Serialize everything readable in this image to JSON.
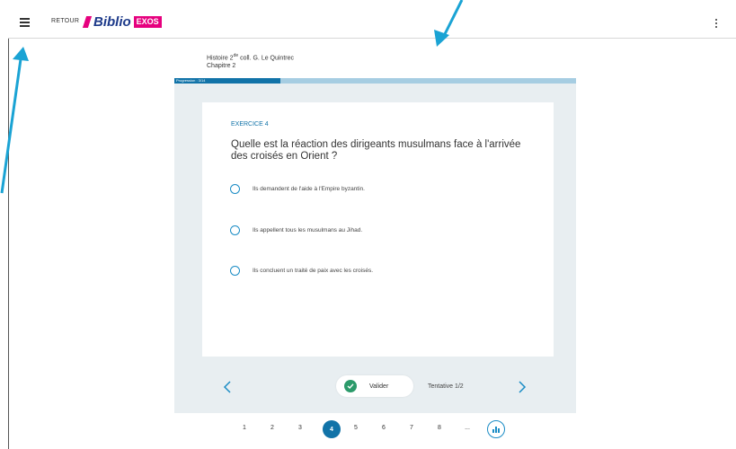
{
  "topbar": {
    "back_label": "RETOUR",
    "logo_text": "Biblio",
    "logo_badge": "EXOS"
  },
  "book": {
    "title_prefix": "Histoire 2",
    "title_sup": "de",
    "title_suffix": " coll. G. Le Quintrec",
    "chapter": "Chapitre 2"
  },
  "progress": {
    "label": "Progression : 3/14",
    "fraction": 0.265
  },
  "exercise": {
    "label": "EXERCICE 4",
    "question": "Quelle est la réaction des dirigeants musulmans face à l'arrivée des croisés en Orient ?",
    "options": [
      "Ils demandent de l'aide à l'Empire byzantin.",
      "Ils appellent tous les musulmans au Jihad.",
      "Ils concluent un traité de paix avec les croisés."
    ]
  },
  "actions": {
    "validate_label": "Valider",
    "attempt_label": "Tentative 1/2"
  },
  "pager": {
    "pages": [
      "1",
      "2",
      "3",
      "4",
      "5",
      "6",
      "7",
      "8",
      "..."
    ],
    "active": "4"
  },
  "colors": {
    "accent": "#1173a8",
    "progress_track": "#a6cde2",
    "panel_bg": "#e8eef1",
    "logo_pink": "#e6007e",
    "logo_blue": "#1d3a8a",
    "success": "#2b9a6a",
    "annotation_arrow": "#1aa3d4"
  },
  "icons": {
    "menu": "hamburger-icon",
    "more": "kebab-icon",
    "prev": "chevron-left-icon",
    "next": "chevron-right-icon",
    "validate": "check-icon",
    "stats": "bar-chart-icon"
  }
}
